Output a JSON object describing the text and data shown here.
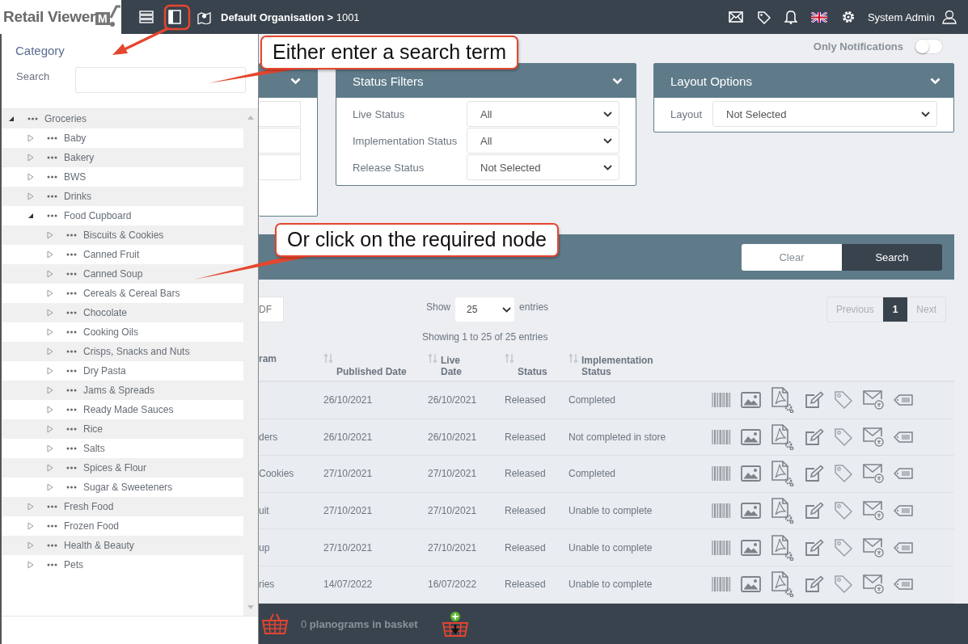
{
  "header": {
    "logo": {
      "text": "Retail Viewer",
      "mark": "M"
    },
    "breadcrumb": "**Default Organisation >** 1001",
    "user": "System Admin"
  },
  "sidebar": {
    "title": "Category",
    "search_label": "Search",
    "tree": [
      {
        "label": "Groceries",
        "expanded": true,
        "children": [
          {
            "label": "Baby",
            "expanded": false
          },
          {
            "label": "Bakery",
            "expanded": false
          },
          {
            "label": "BWS",
            "expanded": false
          },
          {
            "label": "Drinks",
            "expanded": false
          },
          {
            "label": "Food Cupboard",
            "expanded": true,
            "children": [
              {
                "label": "Biscuits & Cookies",
                "expanded": false
              },
              {
                "label": "Canned Fruit",
                "expanded": false
              },
              {
                "label": "Canned Soup",
                "expanded": false
              },
              {
                "label": "Cereals & Cereal Bars",
                "expanded": false
              },
              {
                "label": "Chocolate",
                "expanded": false
              },
              {
                "label": "Cooking Oils",
                "expanded": false
              },
              {
                "label": "Crisps, Snacks and Nuts",
                "expanded": false
              },
              {
                "label": "Dry Pasta",
                "expanded": false
              },
              {
                "label": "Jams & Spreads",
                "expanded": false
              },
              {
                "label": "Ready Made Sauces",
                "expanded": false
              },
              {
                "label": "Rice",
                "expanded": false
              },
              {
                "label": "Salts",
                "expanded": false
              },
              {
                "label": "Spices & Flour",
                "expanded": false
              },
              {
                "label": "Sugar & Sweeteners",
                "expanded": false
              }
            ]
          },
          {
            "label": "Fresh Food",
            "expanded": false
          },
          {
            "label": "Frozen Food",
            "expanded": false
          },
          {
            "label": "Health & Beauty",
            "expanded": false
          },
          {
            "label": "Pets",
            "expanded": false
          }
        ]
      }
    ]
  },
  "notifications_toggle": {
    "label": "Only Notifications",
    "on": false
  },
  "filter_panels": [
    {
      "title": "Status Filters",
      "fields": [
        {
          "label": "Live Status",
          "value": "All"
        },
        {
          "label": "Implementation Status",
          "value": "All"
        },
        {
          "label": "Release Status",
          "value": "Not Selected"
        }
      ]
    },
    {
      "title": "Layout Options",
      "fields": [
        {
          "label": "Layout",
          "value": "Not Selected"
        }
      ]
    }
  ],
  "search_bar": {
    "buttons": [
      {
        "label": "Clear",
        "kind": "secondary"
      },
      {
        "label": "Search",
        "kind": "primary"
      }
    ]
  },
  "table_controls": {
    "export_button": "DF",
    "show_label": "Show",
    "page_size": "25",
    "entries_label": "entries",
    "summary": "Showing 1 to 25 of 25 entries",
    "pagination": [
      {
        "label": "Previous",
        "disabled": true,
        "selected": false
      },
      {
        "label": "1",
        "disabled": false,
        "selected": true
      },
      {
        "label": "Next",
        "disabled": true,
        "selected": false
      }
    ]
  },
  "table": {
    "columns": [
      "ram",
      "Published Date",
      "Live Date",
      "Status",
      "Implementation Status"
    ],
    "rows": [
      {
        "published_date": "26/10/2021",
        "live_date": "26/10/2021",
        "status": "Released",
        "implementation_status": "Completed"
      },
      {
        "name": "ders",
        "published_date": "26/10/2021",
        "live_date": "26/10/2021",
        "status": "Released",
        "implementation_status": "Not completed in store"
      },
      {
        "name": "Cookies",
        "published_date": "27/10/2021",
        "live_date": "27/10/2021",
        "status": "Released",
        "implementation_status": "Completed"
      },
      {
        "name": "uit",
        "published_date": "27/10/2021",
        "live_date": "27/10/2021",
        "status": "Released",
        "implementation_status": "Unable to complete"
      },
      {
        "name": "up",
        "published_date": "27/10/2021",
        "live_date": "27/10/2021",
        "status": "Released",
        "implementation_status": "Unable to complete"
      },
      {
        "name": "ries",
        "published_date": "14/07/2022",
        "live_date": "16/07/2022",
        "status": "Released",
        "implementation_status": "Unable to complete"
      }
    ]
  },
  "basket": {
    "text": "0 **planograms in basket**"
  },
  "callouts": [
    {
      "text": "Either enter a search term"
    },
    {
      "text": "Or click on the required node"
    }
  ]
}
